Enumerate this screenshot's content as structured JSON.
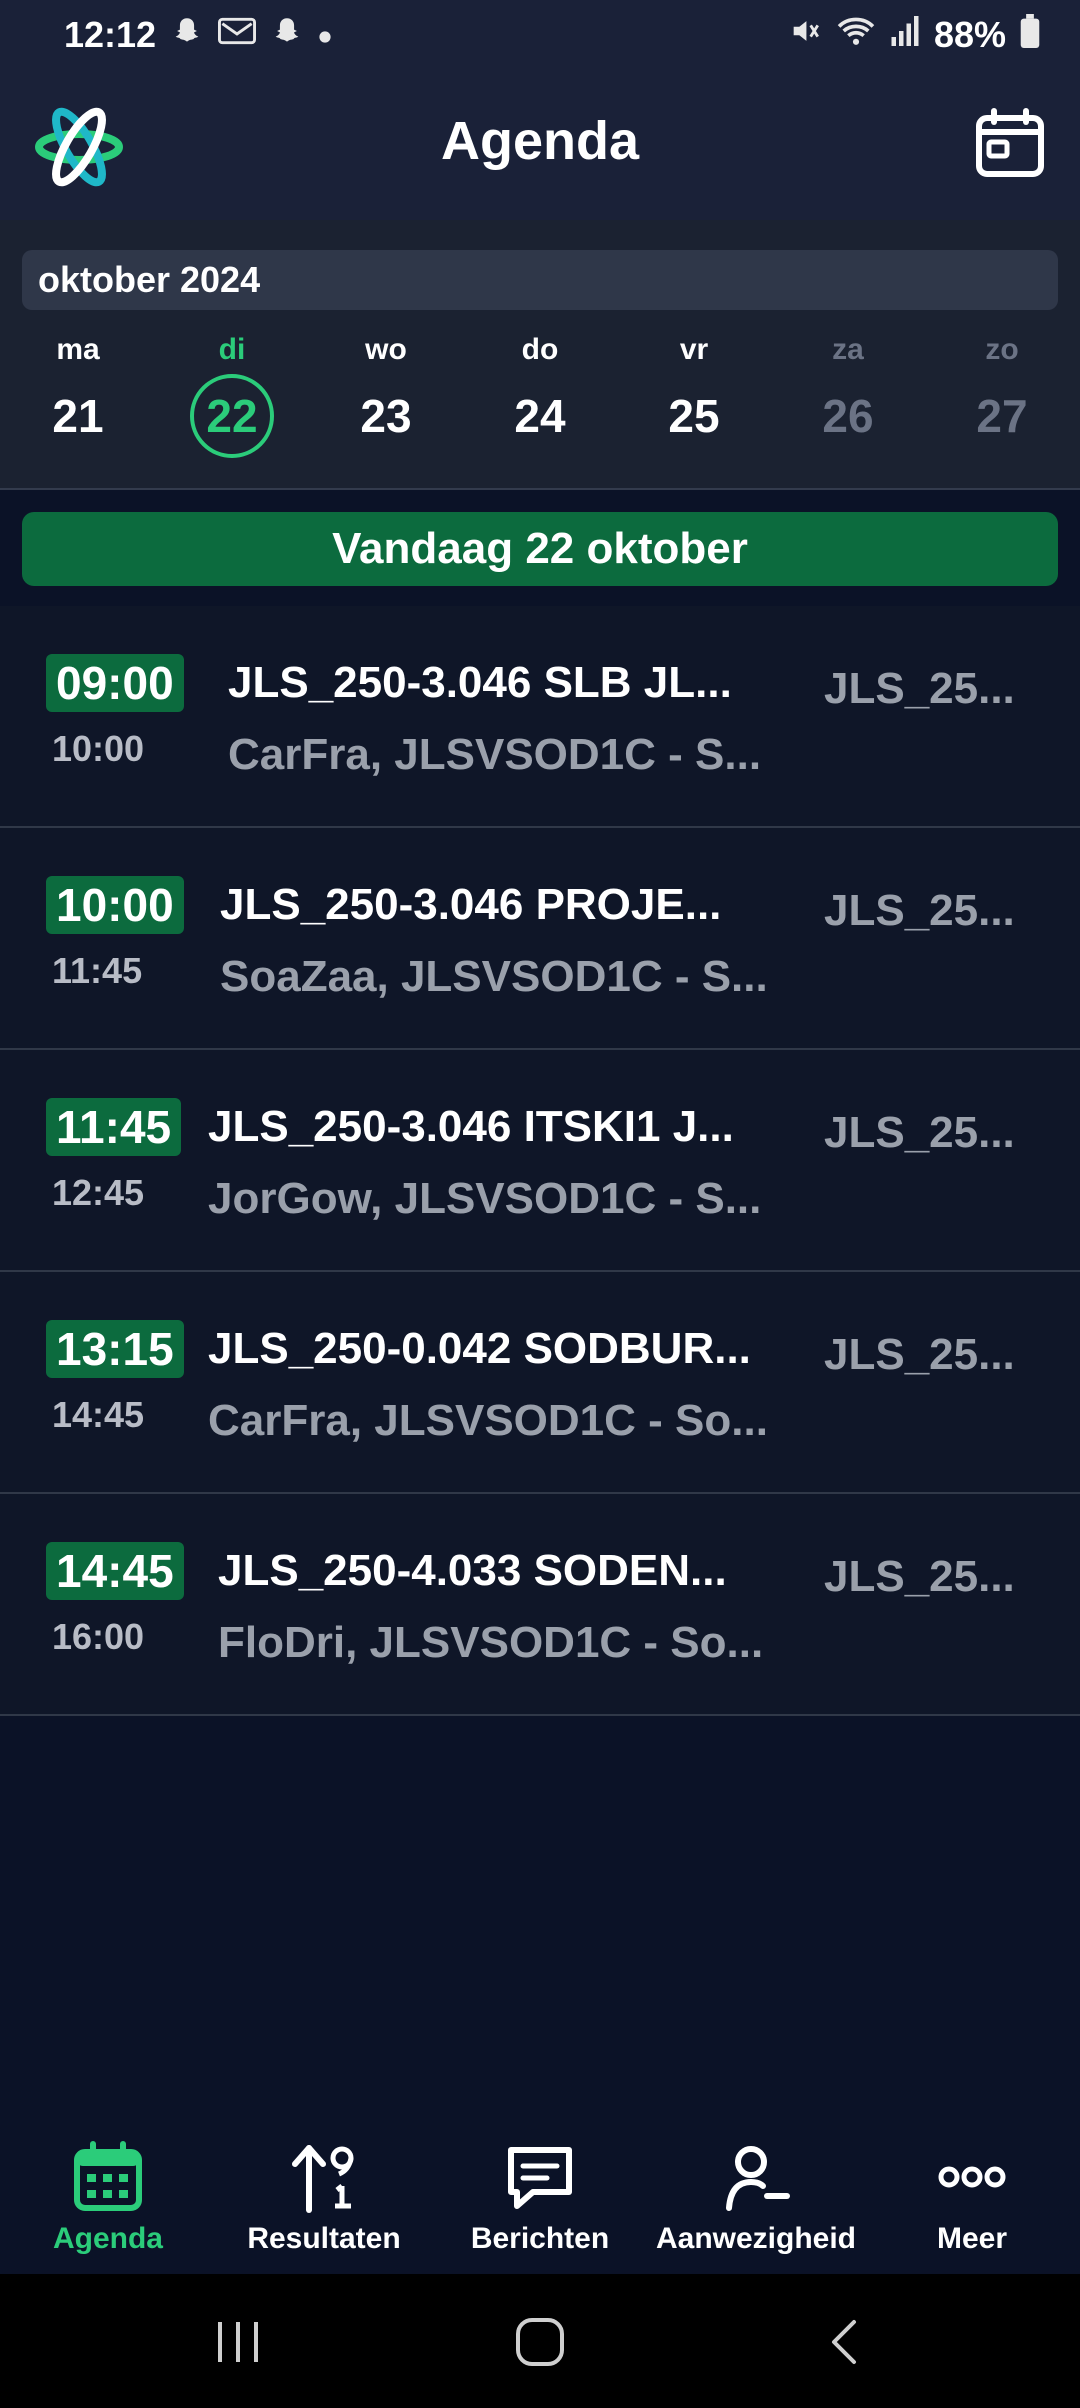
{
  "status_bar": {
    "time": "12:12",
    "notification_icons": [
      "snapchat-icon",
      "mail-icon",
      "snapchat-icon",
      "dot-icon"
    ],
    "battery": "88%"
  },
  "header": {
    "title": "Agenda"
  },
  "week": {
    "month_label": "oktober 2024",
    "days": [
      {
        "name": "ma",
        "num": "21",
        "state": "normal"
      },
      {
        "name": "di",
        "num": "22",
        "state": "today"
      },
      {
        "name": "wo",
        "num": "23",
        "state": "normal"
      },
      {
        "name": "do",
        "num": "24",
        "state": "normal"
      },
      {
        "name": "vr",
        "num": "25",
        "state": "normal"
      },
      {
        "name": "za",
        "num": "26",
        "state": "weekend"
      },
      {
        "name": "zo",
        "num": "27",
        "state": "weekend"
      }
    ]
  },
  "today_banner": "Vandaag 22 oktober",
  "events": [
    {
      "start": "09:00",
      "end": "10:00",
      "title": "JLS_250-3.046 SLB JL...",
      "sub": "CarFra, JLSVSOD1C - S...",
      "right": "JLS_25..."
    },
    {
      "start": "10:00",
      "end": "11:45",
      "title": "JLS_250-3.046 PROJE...",
      "sub": "SoaZaa, JLSVSOD1C - S...",
      "right": "JLS_25..."
    },
    {
      "start": "11:45",
      "end": "12:45",
      "title": "JLS_250-3.046 ITSKI1 J...",
      "sub": "JorGow, JLSVSOD1C - S...",
      "right": "JLS_25..."
    },
    {
      "start": "13:15",
      "end": "14:45",
      "title": "JLS_250-0.042 SODBUR...",
      "sub": "CarFra, JLSVSOD1C - So...",
      "right": "JLS_25..."
    },
    {
      "start": "14:45",
      "end": "16:00",
      "title": "JLS_250-4.033 SODEN...",
      "sub": "FloDri, JLSVSOD1C - So...",
      "right": "JLS_25..."
    }
  ],
  "bottom_nav": [
    {
      "label": "Agenda",
      "icon": "calendar-grid-icon",
      "active": true
    },
    {
      "label": "Resultaten",
      "icon": "results-icon",
      "active": false
    },
    {
      "label": "Berichten",
      "icon": "message-icon",
      "active": false
    },
    {
      "label": "Aanwezigheid",
      "icon": "attendance-icon",
      "active": false
    },
    {
      "label": "Meer",
      "icon": "more-icon",
      "active": false
    }
  ],
  "colors": {
    "accent": "#2bcc7a",
    "today_banner": "#0c6b3e",
    "background": "#0b1227",
    "header": "#1a2138"
  }
}
